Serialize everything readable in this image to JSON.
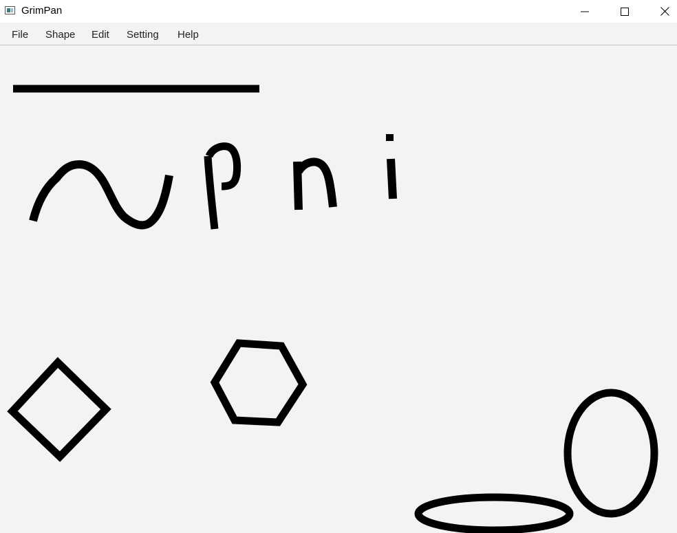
{
  "window": {
    "title": "GrimPan",
    "controls": [
      "minimize",
      "maximize",
      "close"
    ]
  },
  "menubar": {
    "items": [
      {
        "label": "File"
      },
      {
        "label": "Shape"
      },
      {
        "label": "Edit"
      },
      {
        "label": "Setting"
      },
      {
        "label": "Help"
      }
    ]
  },
  "canvas": {
    "background": "#f3f3f3",
    "stroke_color": "#000000",
    "shapes": [
      {
        "type": "line",
        "name": "line"
      },
      {
        "type": "pencil",
        "name": "freehand-wave"
      },
      {
        "type": "pencil",
        "name": "freehand-p"
      },
      {
        "type": "pencil",
        "name": "freehand-n"
      },
      {
        "type": "pencil",
        "name": "freehand-i"
      },
      {
        "type": "polygon",
        "name": "diamond",
        "sides": 4
      },
      {
        "type": "polygon",
        "name": "hexagon",
        "sides": 6
      },
      {
        "type": "oval",
        "name": "horizontal-oval"
      },
      {
        "type": "oval",
        "name": "vertical-oval"
      }
    ]
  },
  "colors": {
    "titlebar": "#ffffff",
    "menubar": "#f3f3f3",
    "canvas": "#f3f3f3",
    "stroke": "#000000"
  }
}
